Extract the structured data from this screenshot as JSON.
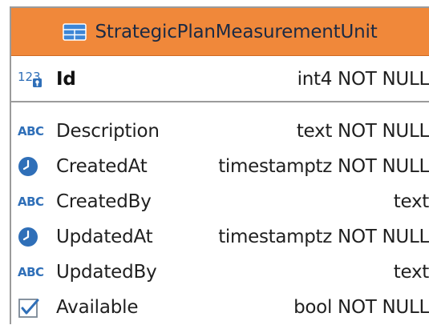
{
  "table": {
    "name": "StrategicPlanMeasurementUnit",
    "header_color": "#f0883a"
  },
  "primary_key": {
    "name": "Id",
    "type": "int4 NOT NULL",
    "icon": "numeric-key-icon"
  },
  "columns": [
    {
      "name": "Description",
      "type": "text NOT NULL",
      "icon": "abc-text-icon"
    },
    {
      "name": "CreatedAt",
      "type": "timestamptz NOT NULL",
      "icon": "clock-icon"
    },
    {
      "name": "CreatedBy",
      "type": "text",
      "icon": "abc-text-icon"
    },
    {
      "name": "UpdatedAt",
      "type": "timestamptz NOT NULL",
      "icon": "clock-icon"
    },
    {
      "name": "UpdatedBy",
      "type": "text",
      "icon": "abc-text-icon"
    },
    {
      "name": "Available",
      "type": "bool NOT NULL",
      "icon": "checkbox-icon"
    }
  ],
  "icon_glyphs": {
    "abc": "ABC",
    "numeric": "123"
  },
  "colors": {
    "icon_blue": "#2f6fb8",
    "border": "#9b9b9b"
  }
}
